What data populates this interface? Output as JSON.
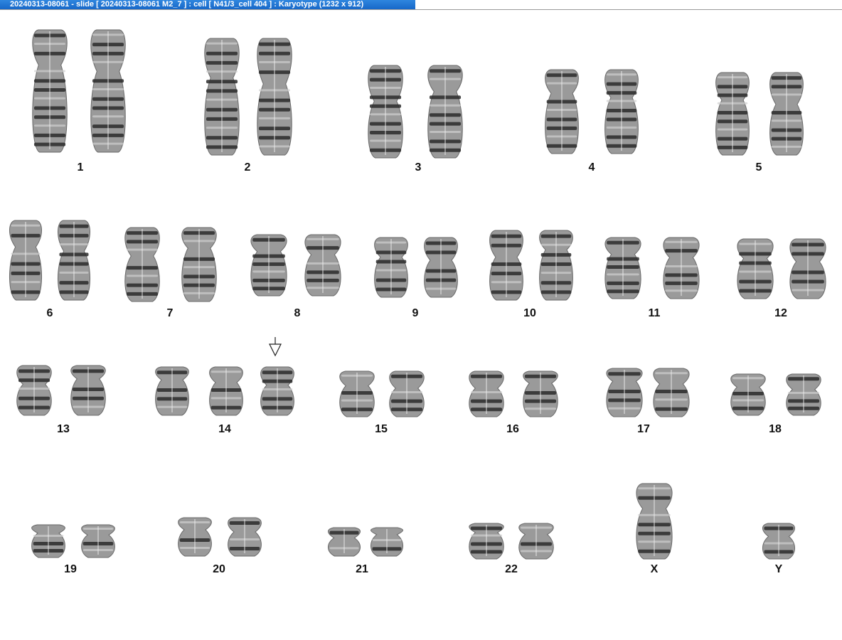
{
  "window": {
    "title": "20240313-08061 - slide [ 20240313-08061 M2_7 ] : cell [ N41/3_cell 404 ] : Karyotype  (1232 x 912)"
  },
  "karyotype": {
    "rows": [
      {
        "groups": [
          {
            "label": "1",
            "chromosomes": 2
          },
          {
            "label": "2",
            "chromosomes": 2
          },
          {
            "label": "3",
            "chromosomes": 2
          },
          {
            "label": "4",
            "chromosomes": 2
          },
          {
            "label": "5",
            "chromosomes": 2
          }
        ]
      },
      {
        "groups": [
          {
            "label": "6",
            "chromosomes": 2
          },
          {
            "label": "7",
            "chromosomes": 2
          },
          {
            "label": "8",
            "chromosomes": 2
          },
          {
            "label": "9",
            "chromosomes": 2
          },
          {
            "label": "10",
            "chromosomes": 2
          },
          {
            "label": "11",
            "chromosomes": 2
          },
          {
            "label": "12",
            "chromosomes": 2
          }
        ]
      },
      {
        "groups": [
          {
            "label": "13",
            "chromosomes": 2
          },
          {
            "label": "14",
            "chromosomes": 3
          },
          {
            "label": "15",
            "chromosomes": 2
          },
          {
            "label": "16",
            "chromosomes": 2
          },
          {
            "label": "17",
            "chromosomes": 2
          },
          {
            "label": "18",
            "chromosomes": 2
          }
        ]
      },
      {
        "groups": [
          {
            "label": "19",
            "chromosomes": 2
          },
          {
            "label": "20",
            "chromosomes": 2
          },
          {
            "label": "21",
            "chromosomes": 2
          },
          {
            "label": "22",
            "chromosomes": 2
          },
          {
            "label": "X",
            "chromosomes": 1
          },
          {
            "label": "Y",
            "chromosomes": 1
          }
        ]
      }
    ],
    "marker": {
      "type": "down-arrow-icon",
      "group": "14"
    }
  },
  "colors": {
    "titlebar": "#1e6fd0",
    "chromosome": "#2a2a2a",
    "label": "#111111"
  }
}
